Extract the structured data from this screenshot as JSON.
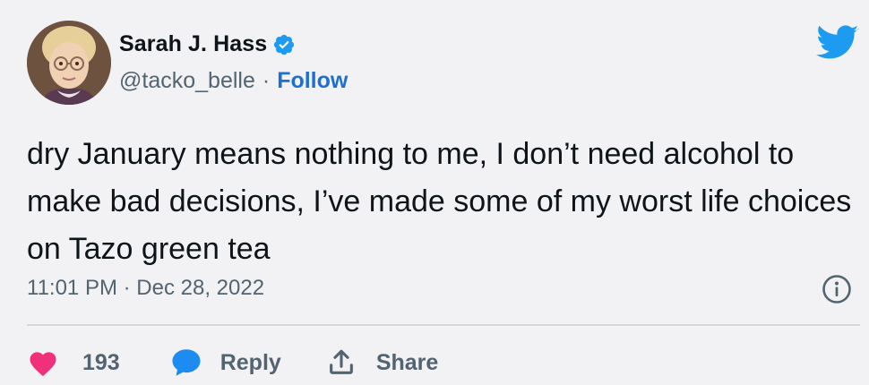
{
  "author": {
    "name": "Sarah J. Hass",
    "handle": "@tacko_belle",
    "separator": "·",
    "follow_label": "Follow",
    "verified": true
  },
  "tweet": {
    "text": "dry January means nothing to me, I don’t need alcohol to make bad decisions, I’ve made some of my worst life choices on Tazo green tea",
    "timestamp": "11:01 PM · Dec 28, 2022"
  },
  "actions": {
    "like_count": "193",
    "reply_label": "Reply",
    "share_label": "Share"
  },
  "icons": {
    "brand": "twitter-bird-icon",
    "info": "info-icon",
    "like": "heart-icon",
    "reply": "speech-bubble-icon",
    "share": "share-upload-icon"
  },
  "colors": {
    "background": "#f2f2f4",
    "text": "#0f1419",
    "secondary": "#536471",
    "accent_blue": "#1d9bf0",
    "follow_blue": "#1d6fd1",
    "heart": "#f0307a",
    "reply_bubble": "#1d8cf0",
    "divider": "#d4d8dc"
  }
}
